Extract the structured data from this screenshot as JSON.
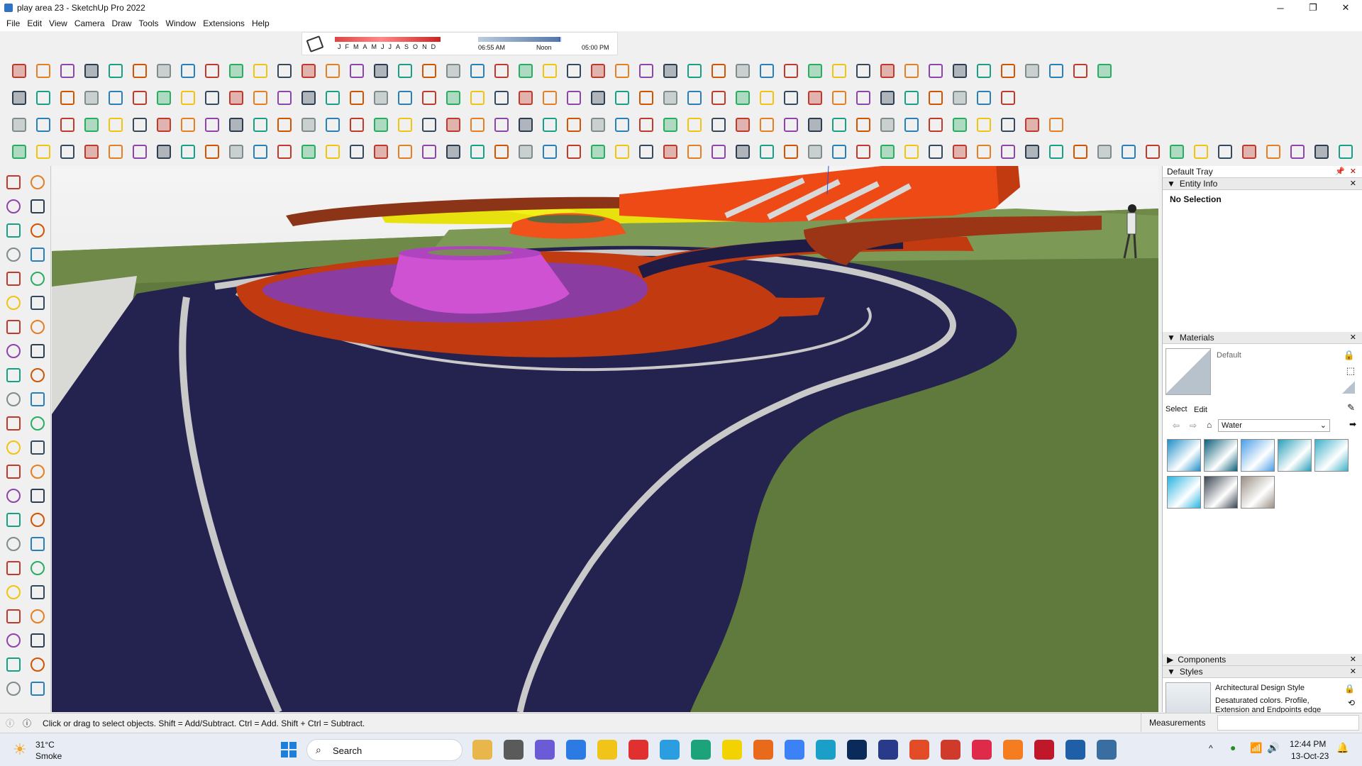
{
  "window": {
    "title": "play area 23 - SketchUp Pro 2022",
    "minimize": "─",
    "maximize": "❐",
    "close": "✕"
  },
  "menu": [
    "File",
    "Edit",
    "View",
    "Camera",
    "Draw",
    "Tools",
    "Window",
    "Extensions",
    "Help"
  ],
  "shadow_settings": {
    "months": [
      "J",
      "F",
      "M",
      "A",
      "M",
      "J",
      "J",
      "A",
      "S",
      "O",
      "N",
      "D"
    ],
    "time_start": "06:55 AM",
    "time_noon": "Noon",
    "time_end": "05:00 PM"
  },
  "tray": {
    "title": "Default Tray",
    "entity_info": {
      "header": "Entity Info",
      "value": "No Selection"
    },
    "materials": {
      "header": "Materials",
      "current": "Default",
      "tab_select": "Select",
      "tab_edit": "Edit",
      "library": "Water",
      "swatch_colors": [
        "#1f8fc8",
        "#0b5f7a",
        "#4a9ee8",
        "#2a9fb8",
        "#3fb0c8",
        "#29b4e0",
        "#3a4450",
        "#9a8f84"
      ]
    },
    "components": {
      "header": "Components"
    },
    "styles": {
      "header": "Styles",
      "name": "Architectural Design Style",
      "description": "Desaturated colors. Profile, Extension and Endpoints edge effects and sky enabled."
    }
  },
  "status": {
    "hint": "Click or drag to select objects. Shift = Add/Subtract. Ctrl = Add. Shift + Ctrl = Subtract.",
    "measurements_label": "Measurements"
  },
  "taskbar": {
    "weather_temp": "31°C",
    "weather_desc": "Smoke",
    "search_label": "Search",
    "time": "12:44 PM",
    "date": "13-Oct-23"
  }
}
